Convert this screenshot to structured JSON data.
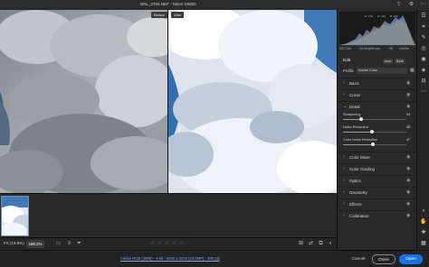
{
  "window": {
    "title": "BNL_2765.NEF  -  Nikon D5500"
  },
  "compare": {
    "before_label": "Before",
    "after_label": "After"
  },
  "toolbar": {
    "fit_label": "FX (19.8%)",
    "zoom_value": "198.2%",
    "stars": [
      "☆",
      "☆",
      "☆",
      "☆",
      "☆"
    ]
  },
  "status": {
    "image_info": "Adobe RGB (1998) - 8 bit - 6000 x 4000 (24.0MP) - 300 ppi",
    "cancel": "Cancel",
    "done": "Done",
    "open": "Open"
  },
  "histogram": {
    "readouts": [
      "R: 176",
      "G: 194",
      "B: 208"
    ],
    "camera": [
      "ISO 100",
      "18-55@55 mm",
      "f/8",
      "1/500s"
    ]
  },
  "edit": {
    "title": "Edit",
    "auto": "Auto",
    "bw": "B&W",
    "profile_label": "Profile",
    "profile_value": "Adobe Color",
    "sections_top": [
      {
        "label": "Basic",
        "expanded": false
      },
      {
        "label": "Curve",
        "expanded": false
      },
      {
        "label": "Detail",
        "expanded": true
      }
    ],
    "detail_sliders": [
      {
        "label": "Sharpening",
        "value": "44",
        "fraction": 0.29
      },
      {
        "label": "Noise Reduction",
        "value": "45",
        "fraction": 0.45
      },
      {
        "label": "Color Noise Reduction",
        "value": "47",
        "fraction": 0.47
      }
    ],
    "sections_bottom": [
      {
        "label": "Color Mixer"
      },
      {
        "label": "Color Grading"
      },
      {
        "label": "Optics"
      },
      {
        "label": "Geometry"
      },
      {
        "label": "Effects"
      },
      {
        "label": "Calibration"
      }
    ]
  },
  "colors": {
    "accent": "#1473e6",
    "sky_blue": "#3f79b8"
  }
}
